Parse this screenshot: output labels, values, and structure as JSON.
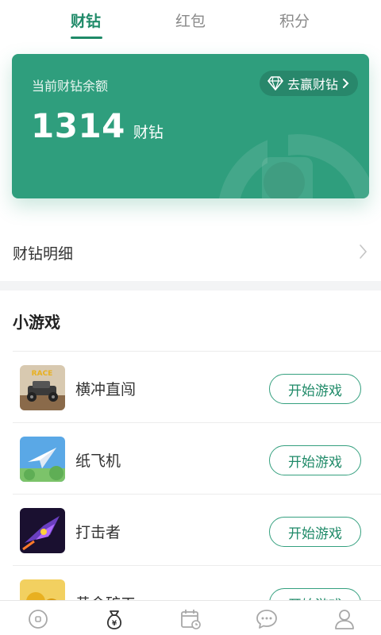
{
  "tabs": [
    {
      "label": "财钻",
      "active": true
    },
    {
      "label": "红包",
      "active": false
    },
    {
      "label": "积分",
      "active": false
    }
  ],
  "card": {
    "label": "当前财钻余额",
    "win_button": "去赢财钻",
    "balance": "1314",
    "unit": "财钻",
    "color": "#2f9e7d"
  },
  "detail": {
    "label": "财钻明细"
  },
  "games_section": {
    "title": "小游戏",
    "items": [
      {
        "name": "横冲直闯",
        "button": "开始游戏",
        "icon": "racing-game-icon"
      },
      {
        "name": "纸飞机",
        "button": "开始游戏",
        "icon": "paper-plane-game-icon"
      },
      {
        "name": "打击者",
        "button": "开始游戏",
        "icon": "striker-game-icon"
      },
      {
        "name": "黄金矿工",
        "button": "开始游戏",
        "icon": "gold-miner-game-icon"
      }
    ]
  },
  "bottom_nav": [
    {
      "icon": "home-icon",
      "active": false
    },
    {
      "icon": "money-bag-icon",
      "active": true
    },
    {
      "icon": "calendar-icon",
      "active": false
    },
    {
      "icon": "chat-icon",
      "active": false
    },
    {
      "icon": "profile-icon",
      "active": false
    }
  ],
  "colors": {
    "accent": "#1f8a68",
    "card": "#2f9e7d"
  }
}
